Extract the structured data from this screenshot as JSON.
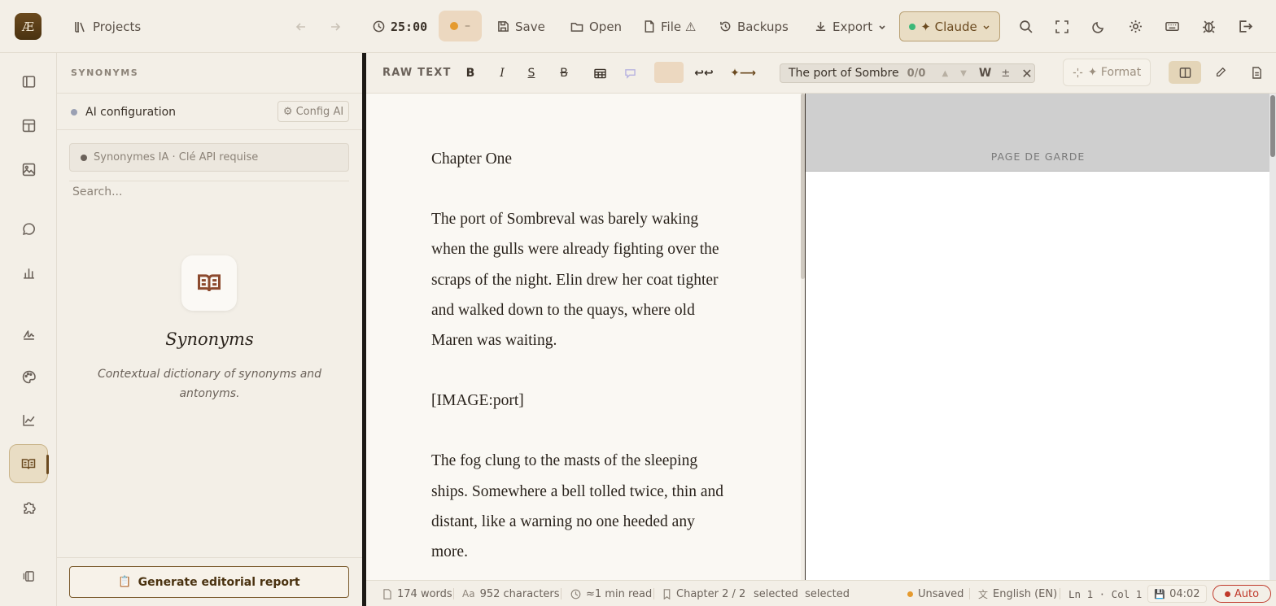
{
  "app": {
    "logo_text": "Æ"
  },
  "topbar": {
    "projects_label": "Projects",
    "timer": "25:00",
    "pomodoro_status": "–",
    "save_label": "Save",
    "open_label": "Open",
    "file_label": "File ⚠",
    "backups_label": "Backups",
    "export_label": "Export",
    "ai_model": "✦ Claude"
  },
  "rail": {
    "active_item": "synonyms",
    "items": [
      "sidebar-toggle",
      "layout",
      "image",
      "chat",
      "bar-chart",
      "signature",
      "palette",
      "line-chart",
      "synonyms",
      "puzzle",
      "collapse"
    ]
  },
  "panel": {
    "title": "SYNONYMS",
    "ai_config_label": "AI configuration",
    "config_button": "⚙ Config AI",
    "api_notice": "Synonymes IA · Clé API requise",
    "search_placeholder": "Search...",
    "empty_title": "Synonyms",
    "empty_description": "Contextual dictionary of synonyms and antonyms.",
    "report_button": "Generate editorial report"
  },
  "editor_toolbar": {
    "mode_label": "RAW TEXT",
    "bold": "B",
    "italic": "I",
    "underline": "S",
    "strike": "B",
    "wrap_glyph": "↩↩",
    "insert_glyph": "✦⟶",
    "find_query": "The port of Sombre",
    "find_count": "0/0",
    "find_word": "W",
    "find_case": "±",
    "format_button": "✦ Format"
  },
  "document": {
    "paragraphs": [
      "Chapter One",
      "The port of Sombreval was barely waking when the gulls were already fighting over the scraps of the night. Elin drew her coat tighter and walked down to the quays, where old Maren was waiting.",
      "[IMAGE:port]",
      "The fog clung to the masts of the sleeping ships. Somewhere a bell tolled twice, thin and distant, like a warning no one heeded any more."
    ]
  },
  "preview": {
    "page_label": "PAGE DE GARDE"
  },
  "statusbar": {
    "words": "174 words",
    "characters": "952 characters",
    "read_time": "≈1 min read",
    "chapter": "Chapter 2 / 2",
    "selection": "selected  selected",
    "save_state": "Unsaved",
    "language": "English (EN)",
    "cursor": "Ln 1 · Col 1",
    "autosave_time": "04:02",
    "auto_label": "Auto"
  },
  "colors": {
    "accent": "#6b4a1f",
    "background": "#f3efe7",
    "editor_bg": "#faf8f3",
    "unsaved": "#e59a2e",
    "auto": "#c0392b",
    "claude_dot": "#3cb878"
  }
}
